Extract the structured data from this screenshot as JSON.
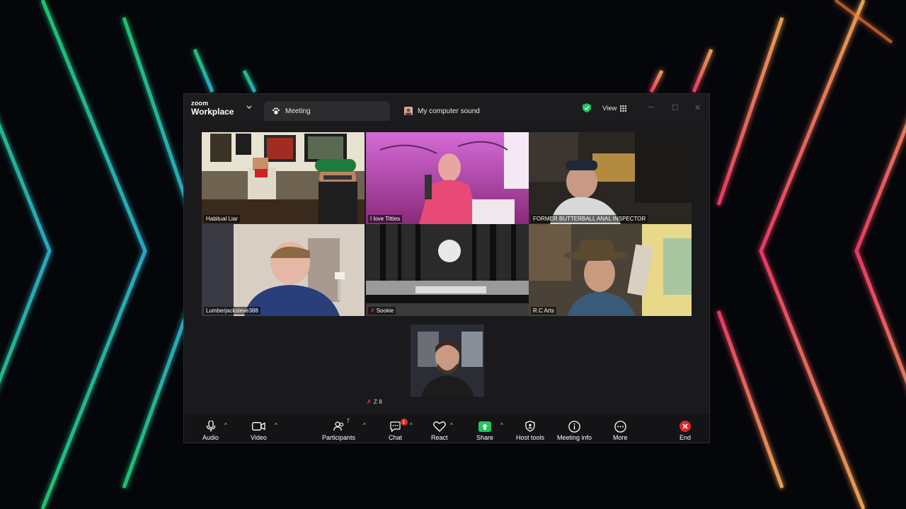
{
  "window": {
    "brand_small": "zoom",
    "brand_big": "Workplace",
    "tabs": [
      {
        "label": "Meeting",
        "icon": "paw-icon",
        "active": true
      },
      {
        "label": "My computer sound",
        "icon": "avatar-icon",
        "active": false
      }
    ],
    "view_label": "View",
    "controls": [
      "minimize-icon",
      "maximize-icon",
      "close-icon"
    ]
  },
  "participants": [
    {
      "name": "Habitual Liar",
      "active_speaker": true,
      "muted": false
    },
    {
      "name": "I love Titties",
      "active_speaker": false,
      "muted": false
    },
    {
      "name": "FORMER BUTTERBALL ANAL INSPECTOR",
      "active_speaker": false,
      "muted": false
    },
    {
      "name": "Lumberjacksteve388",
      "active_speaker": false,
      "muted": false
    },
    {
      "name": "Sookie",
      "active_speaker": false,
      "muted": true
    },
    {
      "name": "R.C Arts",
      "active_speaker": false,
      "muted": false
    }
  ],
  "self_view": {
    "name": "Z 8",
    "muted": true
  },
  "toolbar": {
    "audio": "Audio",
    "video": "Video",
    "participants": "Participants",
    "participants_count": "7",
    "chat": "Chat",
    "chat_badge": "1",
    "react": "React",
    "share": "Share",
    "host_tools": "Host tools",
    "meeting_info": "Meeting info",
    "more": "More",
    "end": "End"
  },
  "colors": {
    "accent_green": "#3ddc84",
    "share_green": "#22c55e",
    "end_red": "#e02828",
    "window_bg": "#1a1a1c"
  }
}
